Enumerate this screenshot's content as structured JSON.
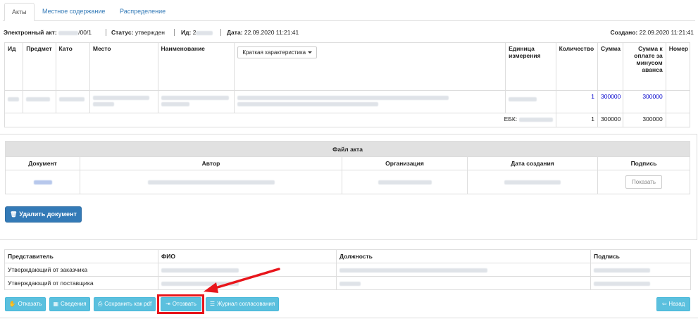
{
  "tabs": [
    {
      "label": "Акты",
      "active": true
    },
    {
      "label": "Местное содержание",
      "active": false
    },
    {
      "label": "Распределение",
      "active": false
    }
  ],
  "info": {
    "act_label": "Электронный акт:",
    "act_value_suffix": "/00/1",
    "status_label": "Статус:",
    "status_value": "утвержден",
    "id_label": "Ид:",
    "id_value_prefix": "2",
    "date_label": "Дата:",
    "date_value": "22.09.2020 11:21:41",
    "created_label": "Создано:",
    "created_value": "22.09.2020 11:21:41"
  },
  "main_table": {
    "headers": [
      "Ид",
      "Предмет",
      "Като",
      "Место",
      "Наименование",
      "",
      "Единица измерения",
      "Количество",
      "Сумма",
      "Сумма к оплате за минусом аванса",
      "Номер"
    ],
    "dropdown_label": "Краткая характеристика",
    "row": {
      "quantity": "1",
      "sum": "300000",
      "sum_after": "300000"
    },
    "ebk_label": "ЕБК:",
    "total": {
      "quantity": "1",
      "sum": "300000",
      "sum_after": "300000"
    }
  },
  "file_table": {
    "title": "Файл акта",
    "headers": [
      "Документ",
      "Автор",
      "Организация",
      "Дата создания",
      "Подпись"
    ],
    "show_button": "Показать"
  },
  "delete_button": "Удалить документ",
  "reps_table": {
    "headers": [
      "Представитель",
      "ФИО",
      "Должность",
      "Подпись"
    ],
    "rows": [
      {
        "role": "Утверждающий от заказчика"
      },
      {
        "role": "Утверждающий от поставщика"
      }
    ]
  },
  "buttons": {
    "reject": "Отказать",
    "info": "Сведения",
    "save_pdf": "Сохранить как pdf",
    "recall": "Отозвать",
    "journal": "Журнал согласования",
    "back": "Назад"
  },
  "colors": {
    "primary": "#337ab7",
    "info": "#5bc0de",
    "highlight": "#e8151b",
    "link": "#0000cc"
  }
}
